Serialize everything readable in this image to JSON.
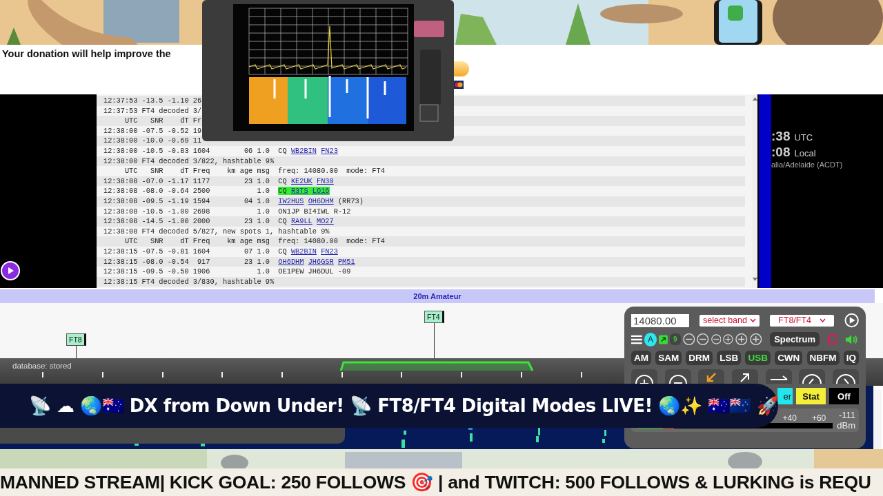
{
  "donation": {
    "text": "Your donation will help improve the"
  },
  "log": {
    "rows": [
      {
        "kind": "text",
        "text": "12:37:53 -13.5 -1.10 26"
      },
      {
        "kind": "text",
        "text": "12:37:53 FT4 decoded 3/"
      },
      {
        "kind": "text",
        "text": "     UTC   SNR    dT Fr"
      },
      {
        "kind": "text",
        "text": "12:38:00 -07.5 -0.52 19"
      },
      {
        "kind": "text",
        "text": "12:38:00 -10.0 -0.69 11"
      },
      {
        "kind": "decode",
        "prefix": "12:38:00 -10.5 -0.83 1604        06 1.0  ",
        "highlight": false,
        "msg": [
          {
            "text": "CQ",
            "link": false
          },
          {
            "text": "WB2BIN",
            "link": true
          },
          {
            "text": "FN23",
            "link": true
          }
        ]
      },
      {
        "kind": "text",
        "text": "12:38:00 FT4 decoded 3/822, hashtable 9%"
      },
      {
        "kind": "text",
        "text": "     UTC   SNR    dT Freq    km age msg  freq: 14080.00  mode: FT4"
      },
      {
        "kind": "decode",
        "prefix": "12:38:08 -07.0 -1.17 1177        23 1.0  ",
        "highlight": false,
        "msg": [
          {
            "text": "CQ",
            "link": false
          },
          {
            "text": "KE2UK",
            "link": true
          },
          {
            "text": "FN30",
            "link": true
          }
        ]
      },
      {
        "kind": "decode",
        "prefix": "12:38:08 -08.0 -0.64 2500           1.0  ",
        "highlight": true,
        "msg": [
          {
            "text": "CQ",
            "link": false
          },
          {
            "text": "R3TS",
            "link": true
          },
          {
            "text": "LO16",
            "link": true
          }
        ]
      },
      {
        "kind": "decode",
        "prefix": "12:38:08 -09.5 -1.19 1594        04 1.0  ",
        "highlight": false,
        "msg": [
          {
            "text": "IW2HUS",
            "link": true
          },
          {
            "text": "OH6DHM",
            "link": true
          },
          {
            "text": "(RR73)",
            "link": false
          }
        ]
      },
      {
        "kind": "text",
        "text": "12:38:08 -10.5 -1.00 2698           1.0  ON1JP BI4IWL R-12"
      },
      {
        "kind": "decode",
        "prefix": "12:38:08 -14.5 -1.00 2000        23 1.0  ",
        "highlight": false,
        "msg": [
          {
            "text": "CQ",
            "link": false
          },
          {
            "text": "RA9LL",
            "link": true
          },
          {
            "text": "MO27",
            "link": true
          }
        ]
      },
      {
        "kind": "text",
        "text": "12:38:08 FT4 decoded 5/827, new spots 1, hashtable 9%"
      },
      {
        "kind": "text",
        "text": "     UTC   SNR    dT Freq    km age msg  freq: 14080.00  mode: FT4"
      },
      {
        "kind": "decode",
        "prefix": "12:38:15 -07.5 -0.81 1604        07 1.0  ",
        "highlight": false,
        "msg": [
          {
            "text": "CQ",
            "link": false
          },
          {
            "text": "WB2BIN",
            "link": true
          },
          {
            "text": "FN23",
            "link": true
          }
        ]
      },
      {
        "kind": "decode",
        "prefix": "12:38:15 -08.0 -0.54  917        23 1.0  ",
        "highlight": false,
        "msg": [
          {
            "text": "OH6DHM",
            "link": true
          },
          {
            "text": "JH6GSR",
            "link": true
          },
          {
            "text": "PM51",
            "link": true
          }
        ]
      },
      {
        "kind": "text",
        "text": "12:38:15 -09.5 -0.50 1906           1.0  OE1PEW JH6DUL -09"
      },
      {
        "kind": "text",
        "text": "12:38:15 FT4 decoded 3/830, hashtable 9%"
      }
    ]
  },
  "clock": {
    "utc": ":38",
    "utc_label": "UTC",
    "local": ":08",
    "local_label": "Local",
    "timezone": "alia/Adelaide (ACDT)"
  },
  "band": {
    "title": "20m Amateur",
    "markers": [
      {
        "label": "FT8"
      },
      {
        "label": "FT4"
      }
    ],
    "status": "database: stored"
  },
  "control_panel": {
    "frequency": "14080.00",
    "band_select": "select band",
    "mode_select": "FT8/FT4",
    "circle_button": "A",
    "zoom_badge": "9",
    "spectrum_button": "Spectrum",
    "modes": [
      {
        "label": "AM",
        "selected": false
      },
      {
        "label": "SAM",
        "selected": false
      },
      {
        "label": "DRM",
        "selected": false
      },
      {
        "label": "LSB",
        "selected": false
      },
      {
        "label": "USB",
        "selected": true
      },
      {
        "label": "CWN",
        "selected": false
      },
      {
        "label": "NBFM",
        "selected": false
      },
      {
        "label": "IQ",
        "selected": false
      }
    ],
    "toggles": [
      {
        "label": "er",
        "color": "#22e6ee"
      },
      {
        "label": "Stat",
        "color": "#f2ee3a"
      },
      {
        "label": "Off",
        "color": "#000000"
      }
    ],
    "s_meter": {
      "scale": [
        "+40",
        "+60"
      ],
      "reading": "-111",
      "unit": "dBm",
      "level": 0.19
    }
  },
  "banner": {
    "text": "📡 ☁ 🌏🇦🇺 DX from Down Under! 📡 FT8/FT4 Digital Modes LIVE! 🌏✨ 🇦🇺🇳🇿 🚀"
  },
  "ticker": {
    "text": "MANNED STREAM| KICK GOAL: 250 FOLLOWS 🎯 | and TWITCH: 500 FOLLOWS & LURKING is REQU"
  }
}
